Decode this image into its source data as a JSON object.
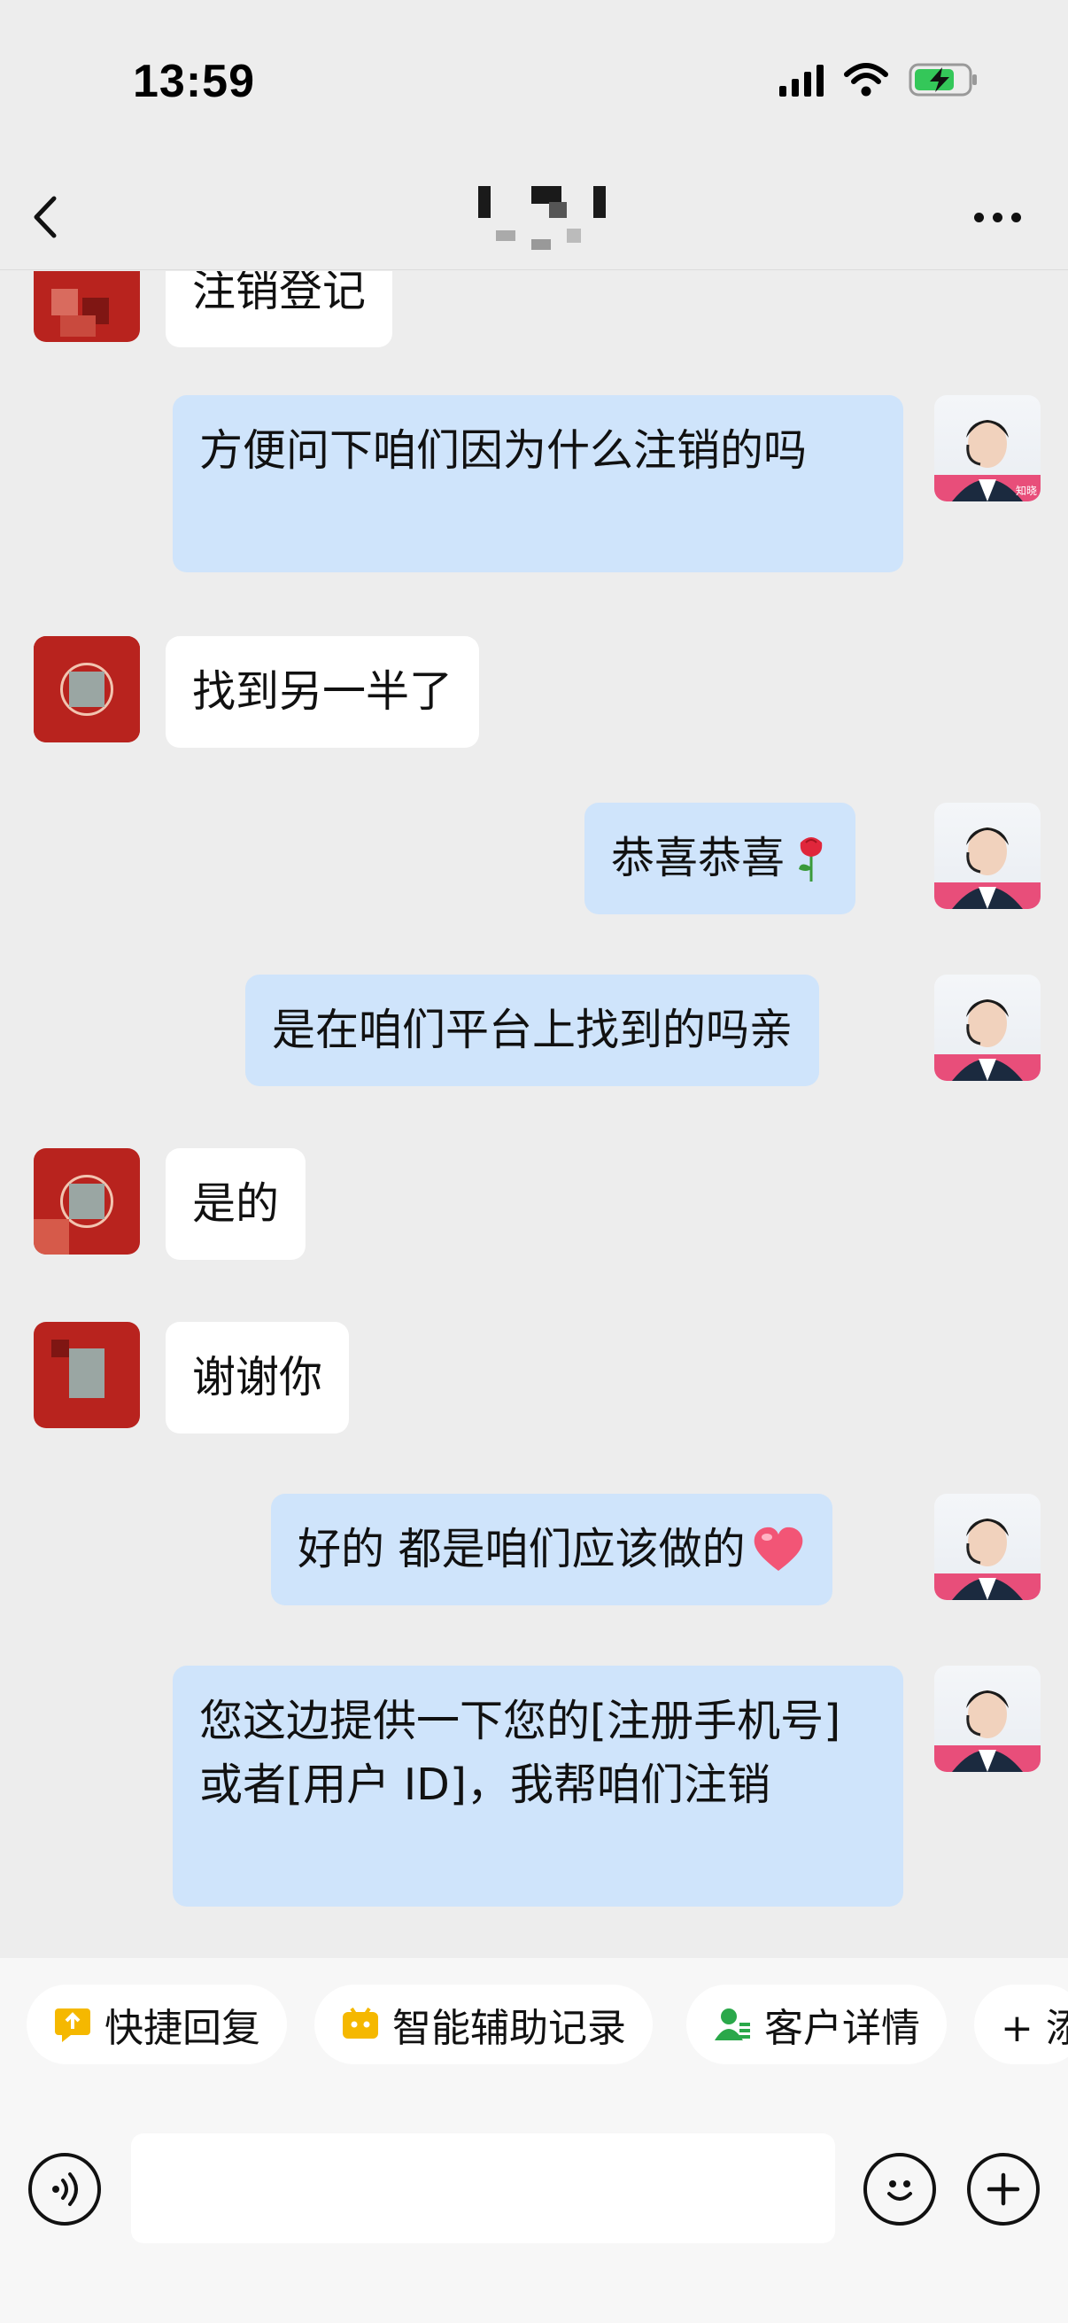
{
  "status_bar": {
    "time": "13:59",
    "icons": [
      "signal-icon",
      "wifi-icon",
      "battery-charging-icon"
    ]
  },
  "header": {
    "title_redacted": true,
    "back_icon": "chevron-left-icon",
    "more_icon": "more-dots-icon"
  },
  "messages": [
    {
      "from": "customer",
      "text": "注销登记",
      "partial": true
    },
    {
      "from": "agent",
      "text": "方便问下咱们因为什么注销的吗"
    },
    {
      "from": "customer",
      "text": "找到另一半了"
    },
    {
      "from": "agent",
      "text": "恭喜恭喜",
      "emoji": "rose-icon"
    },
    {
      "from": "agent",
      "text": "是在咱们平台上找到的吗亲"
    },
    {
      "from": "customer",
      "text": "是的"
    },
    {
      "from": "customer",
      "text": "谢谢你"
    },
    {
      "from": "agent",
      "text": "好的 都是咱们应该做的",
      "emoji": "heart-icon"
    },
    {
      "from": "agent",
      "text": "您这边提供一下您的[注册手机号]或者[用户 ID]，我帮咱们注销"
    }
  ],
  "agent_avatar_badge": "知晓",
  "quick_actions": [
    {
      "label": "快捷回复",
      "icon": "quick-reply-icon",
      "color": "#f5b800"
    },
    {
      "label": "智能辅助记录",
      "icon": "assistant-icon",
      "color": "#f5b800"
    },
    {
      "label": "客户详情",
      "icon": "customer-icon",
      "color": "#2aa84a"
    },
    {
      "label": "+ 添",
      "icon": "",
      "truncated": true
    }
  ],
  "input": {
    "placeholder": "",
    "voice_icon": "voice-icon",
    "emoji_icon": "emoji-icon",
    "plus_icon": "plus-icon"
  },
  "colors": {
    "background": "#ededed",
    "incoming_bubble": "#ffffff",
    "outgoing_bubble": "#cfe4fb",
    "customer_avatar": "#b8231e"
  }
}
